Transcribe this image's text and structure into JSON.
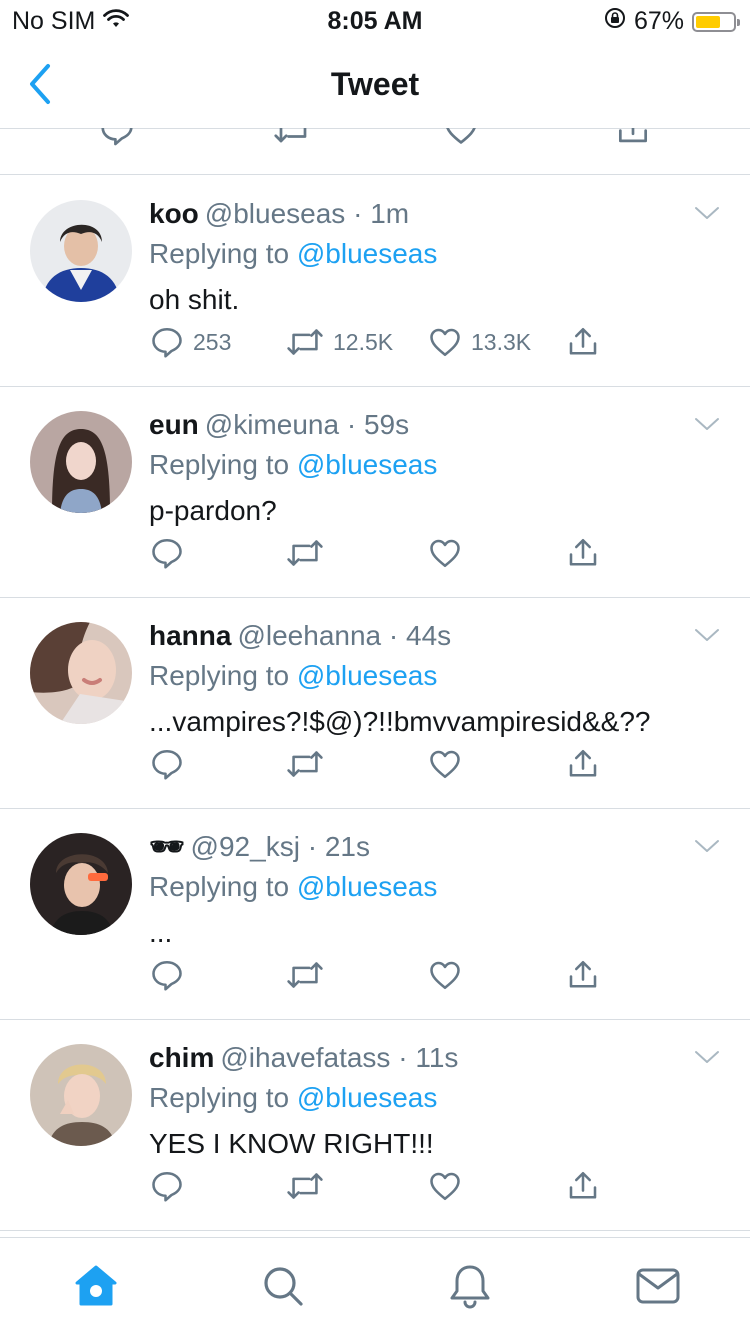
{
  "status_bar": {
    "carrier": "No SIM",
    "time": "8:05 AM",
    "battery_percent": "67%",
    "battery_level": 0.67,
    "battery_color": "#ffcc00"
  },
  "header": {
    "title": "Tweet",
    "back_icon": "chevron-left-icon"
  },
  "colors": {
    "accent": "#1da1f2",
    "muted": "#657786",
    "text": "#14171a",
    "divider": "#d8dde2"
  },
  "tweets": [
    {
      "name": "koo",
      "handle": "@blueseas",
      "time": "1m",
      "replying_prefix": "Replying to",
      "replying_to": "@blueseas",
      "text": "oh shit.",
      "reply_count": "253",
      "retweet_count": "12.5K",
      "like_count": "13.3K"
    },
    {
      "name": "eun",
      "handle": "@kimeuna",
      "time": "59s",
      "replying_prefix": "Replying to",
      "replying_to": "@blueseas",
      "text": "p-pardon?",
      "reply_count": "",
      "retweet_count": "",
      "like_count": ""
    },
    {
      "name": "hanna",
      "handle": "@leehanna",
      "time": "44s",
      "replying_prefix": "Replying to",
      "replying_to": "@blueseas",
      "text": "...vampires?!$@)?!!bmvvampiresid&&??",
      "reply_count": "",
      "retweet_count": "",
      "like_count": ""
    },
    {
      "name": "🕶",
      "handle": "@92_ksj",
      "time": "21s",
      "replying_prefix": "Replying to",
      "replying_to": "@blueseas",
      "text": "...",
      "reply_count": "",
      "retweet_count": "",
      "like_count": ""
    },
    {
      "name": "chim",
      "handle": "@ihavefatass",
      "time": "11s",
      "replying_prefix": "Replying to",
      "replying_to": "@blueseas",
      "text": "YES I KNOW RIGHT!!!",
      "reply_count": "",
      "retweet_count": "",
      "like_count": ""
    }
  ],
  "separator": "·",
  "tab_bar": {
    "items": [
      "home-icon",
      "search-icon",
      "notifications-icon",
      "messages-icon"
    ],
    "active": "home-icon"
  }
}
